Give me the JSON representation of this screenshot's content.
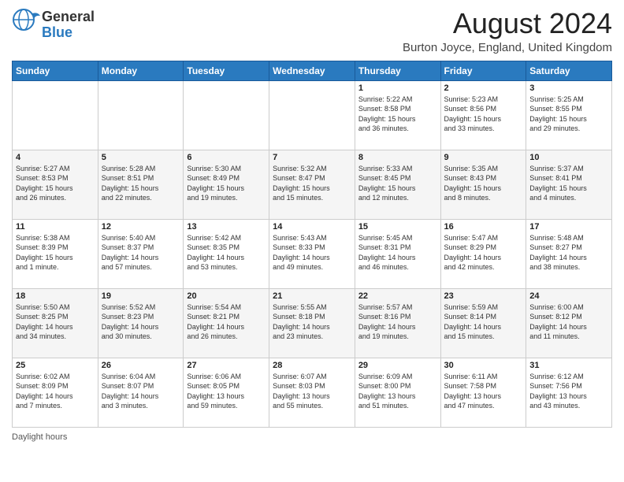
{
  "header": {
    "logo_general": "General",
    "logo_blue": "Blue",
    "month_title": "August 2024",
    "location": "Burton Joyce, England, United Kingdom"
  },
  "days_of_week": [
    "Sunday",
    "Monday",
    "Tuesday",
    "Wednesday",
    "Thursday",
    "Friday",
    "Saturday"
  ],
  "weeks": [
    [
      {
        "day": "",
        "info": ""
      },
      {
        "day": "",
        "info": ""
      },
      {
        "day": "",
        "info": ""
      },
      {
        "day": "",
        "info": ""
      },
      {
        "day": "1",
        "info": "Sunrise: 5:22 AM\nSunset: 8:58 PM\nDaylight: 15 hours\nand 36 minutes."
      },
      {
        "day": "2",
        "info": "Sunrise: 5:23 AM\nSunset: 8:56 PM\nDaylight: 15 hours\nand 33 minutes."
      },
      {
        "day": "3",
        "info": "Sunrise: 5:25 AM\nSunset: 8:55 PM\nDaylight: 15 hours\nand 29 minutes."
      }
    ],
    [
      {
        "day": "4",
        "info": "Sunrise: 5:27 AM\nSunset: 8:53 PM\nDaylight: 15 hours\nand 26 minutes."
      },
      {
        "day": "5",
        "info": "Sunrise: 5:28 AM\nSunset: 8:51 PM\nDaylight: 15 hours\nand 22 minutes."
      },
      {
        "day": "6",
        "info": "Sunrise: 5:30 AM\nSunset: 8:49 PM\nDaylight: 15 hours\nand 19 minutes."
      },
      {
        "day": "7",
        "info": "Sunrise: 5:32 AM\nSunset: 8:47 PM\nDaylight: 15 hours\nand 15 minutes."
      },
      {
        "day": "8",
        "info": "Sunrise: 5:33 AM\nSunset: 8:45 PM\nDaylight: 15 hours\nand 12 minutes."
      },
      {
        "day": "9",
        "info": "Sunrise: 5:35 AM\nSunset: 8:43 PM\nDaylight: 15 hours\nand 8 minutes."
      },
      {
        "day": "10",
        "info": "Sunrise: 5:37 AM\nSunset: 8:41 PM\nDaylight: 15 hours\nand 4 minutes."
      }
    ],
    [
      {
        "day": "11",
        "info": "Sunrise: 5:38 AM\nSunset: 8:39 PM\nDaylight: 15 hours\nand 1 minute."
      },
      {
        "day": "12",
        "info": "Sunrise: 5:40 AM\nSunset: 8:37 PM\nDaylight: 14 hours\nand 57 minutes."
      },
      {
        "day": "13",
        "info": "Sunrise: 5:42 AM\nSunset: 8:35 PM\nDaylight: 14 hours\nand 53 minutes."
      },
      {
        "day": "14",
        "info": "Sunrise: 5:43 AM\nSunset: 8:33 PM\nDaylight: 14 hours\nand 49 minutes."
      },
      {
        "day": "15",
        "info": "Sunrise: 5:45 AM\nSunset: 8:31 PM\nDaylight: 14 hours\nand 46 minutes."
      },
      {
        "day": "16",
        "info": "Sunrise: 5:47 AM\nSunset: 8:29 PM\nDaylight: 14 hours\nand 42 minutes."
      },
      {
        "day": "17",
        "info": "Sunrise: 5:48 AM\nSunset: 8:27 PM\nDaylight: 14 hours\nand 38 minutes."
      }
    ],
    [
      {
        "day": "18",
        "info": "Sunrise: 5:50 AM\nSunset: 8:25 PM\nDaylight: 14 hours\nand 34 minutes."
      },
      {
        "day": "19",
        "info": "Sunrise: 5:52 AM\nSunset: 8:23 PM\nDaylight: 14 hours\nand 30 minutes."
      },
      {
        "day": "20",
        "info": "Sunrise: 5:54 AM\nSunset: 8:21 PM\nDaylight: 14 hours\nand 26 minutes."
      },
      {
        "day": "21",
        "info": "Sunrise: 5:55 AM\nSunset: 8:18 PM\nDaylight: 14 hours\nand 23 minutes."
      },
      {
        "day": "22",
        "info": "Sunrise: 5:57 AM\nSunset: 8:16 PM\nDaylight: 14 hours\nand 19 minutes."
      },
      {
        "day": "23",
        "info": "Sunrise: 5:59 AM\nSunset: 8:14 PM\nDaylight: 14 hours\nand 15 minutes."
      },
      {
        "day": "24",
        "info": "Sunrise: 6:00 AM\nSunset: 8:12 PM\nDaylight: 14 hours\nand 11 minutes."
      }
    ],
    [
      {
        "day": "25",
        "info": "Sunrise: 6:02 AM\nSunset: 8:09 PM\nDaylight: 14 hours\nand 7 minutes."
      },
      {
        "day": "26",
        "info": "Sunrise: 6:04 AM\nSunset: 8:07 PM\nDaylight: 14 hours\nand 3 minutes."
      },
      {
        "day": "27",
        "info": "Sunrise: 6:06 AM\nSunset: 8:05 PM\nDaylight: 13 hours\nand 59 minutes."
      },
      {
        "day": "28",
        "info": "Sunrise: 6:07 AM\nSunset: 8:03 PM\nDaylight: 13 hours\nand 55 minutes."
      },
      {
        "day": "29",
        "info": "Sunrise: 6:09 AM\nSunset: 8:00 PM\nDaylight: 13 hours\nand 51 minutes."
      },
      {
        "day": "30",
        "info": "Sunrise: 6:11 AM\nSunset: 7:58 PM\nDaylight: 13 hours\nand 47 minutes."
      },
      {
        "day": "31",
        "info": "Sunrise: 6:12 AM\nSunset: 7:56 PM\nDaylight: 13 hours\nand 43 minutes."
      }
    ]
  ],
  "footer": {
    "daylight_label": "Daylight hours"
  }
}
